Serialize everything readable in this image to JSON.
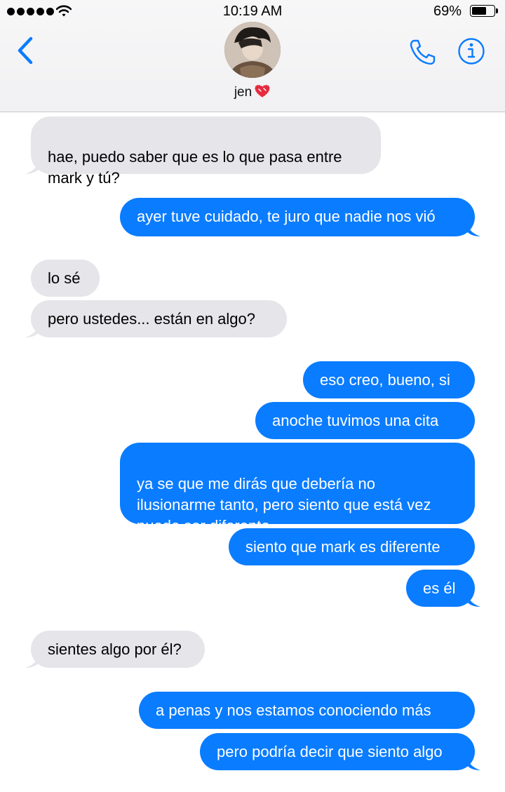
{
  "status_bar": {
    "time": "10:19 AM",
    "battery_percent": "69%",
    "battery_level": 0.69,
    "signal_icon": "signal-dots-icon",
    "wifi_icon": "wifi-icon"
  },
  "header": {
    "contact_name": "jen",
    "contact_emoji": "heart-emoji-icon",
    "back_icon": "chevron-left-icon",
    "phone_icon": "phone-icon",
    "info_icon": "info-icon"
  },
  "colors": {
    "accent": "#0a7cff",
    "incoming_bubble": "#e5e5ea",
    "outgoing_bubble": "#0a7cff"
  },
  "messages": [
    {
      "direction": "incoming",
      "text": "hae, puedo saber que es lo que pasa entre\nmark y tú?"
    },
    {
      "direction": "outgoing",
      "text": "ayer tuve cuidado, te juro que nadie nos vió"
    },
    {
      "direction": "incoming",
      "text": "lo sé"
    },
    {
      "direction": "incoming",
      "text": "pero ustedes... están en algo?"
    },
    {
      "direction": "outgoing",
      "text": "eso creo, bueno, si"
    },
    {
      "direction": "outgoing",
      "text": "anoche tuvimos una cita"
    },
    {
      "direction": "outgoing",
      "text": "ya se que me dirás que debería no\nilusionarme tanto, pero siento que está vez\npuede ser diferente"
    },
    {
      "direction": "outgoing",
      "text": "siento que mark es diferente"
    },
    {
      "direction": "outgoing",
      "text": "es él"
    },
    {
      "direction": "incoming",
      "text": "sientes algo por él?"
    },
    {
      "direction": "outgoing",
      "text": "a penas y nos estamos conociendo más"
    },
    {
      "direction": "outgoing",
      "text": "pero podría decir que siento algo"
    }
  ]
}
